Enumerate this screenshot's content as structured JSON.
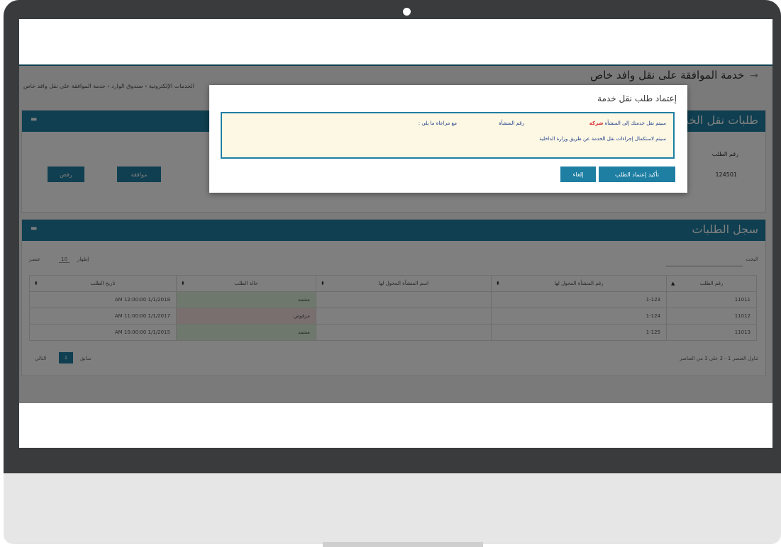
{
  "app": {
    "page_title": "خدمة الموافقة على نقل وافد خاص",
    "breadcrumb": "الخدمات الإلكترونية › صندوق الوارد › خدمة الموافقة على نقل وافد خاص"
  },
  "pending_panel": {
    "title": "طلبات نقل الخدمات",
    "col_request_no": "رقم الطلب",
    "request_no": "124501",
    "approve_button": "موافقة",
    "reject_button": "رفض"
  },
  "history_panel": {
    "title": "سجل الطلبات",
    "search_label": "البحث",
    "show_label": "إظهار",
    "show_value": "10",
    "entries_label": "عنصر",
    "columns": [
      "رقم الطلب",
      "رقم المنشأة المحول لها",
      "اسم المنشأة المحول لها",
      "حالة الطلب",
      "تاريخ الطلب"
    ],
    "rows": [
      {
        "no": "11011",
        "est_no": "1-123",
        "est_name": "",
        "status": "معتمد",
        "date": "AM 12:00:00 1/1/2018"
      },
      {
        "no": "11012",
        "est_no": "1-124",
        "est_name": "",
        "status": "مرفوض",
        "date": "AM 11:00:00 1/1/2017"
      },
      {
        "no": "11013",
        "est_no": "1-125",
        "est_name": "",
        "status": "معتمد",
        "date": "AM 10:00:00 1/1/2015"
      }
    ],
    "footer_info": "تناول العنصر 1 - 3 على 3 من العناصر",
    "pager_prev": "سابق",
    "pager_page": "1",
    "pager_next": "التالي"
  },
  "modal": {
    "title": "إعتماد طلب نقل خدمة",
    "line1_prefix": "سيتم نقل خدمتك إلى المنشأة",
    "line1_company": "شركة",
    "line1_est_no": "رقم المنشأة",
    "line1_suffix": "مع مراعاة ما يلي :",
    "line2": "سيتم لاستكمال إجراءات نقل الخدمة عن طريق وزارة الداخلية",
    "confirm_button": "تأكيد إعتماد الطلب",
    "cancel_button": "إلغاء"
  },
  "colors": {
    "accent": "#1e7fa3",
    "approved": "#dff0d8",
    "rejected": "#f2dede",
    "company_highlight": "#d9272e"
  }
}
